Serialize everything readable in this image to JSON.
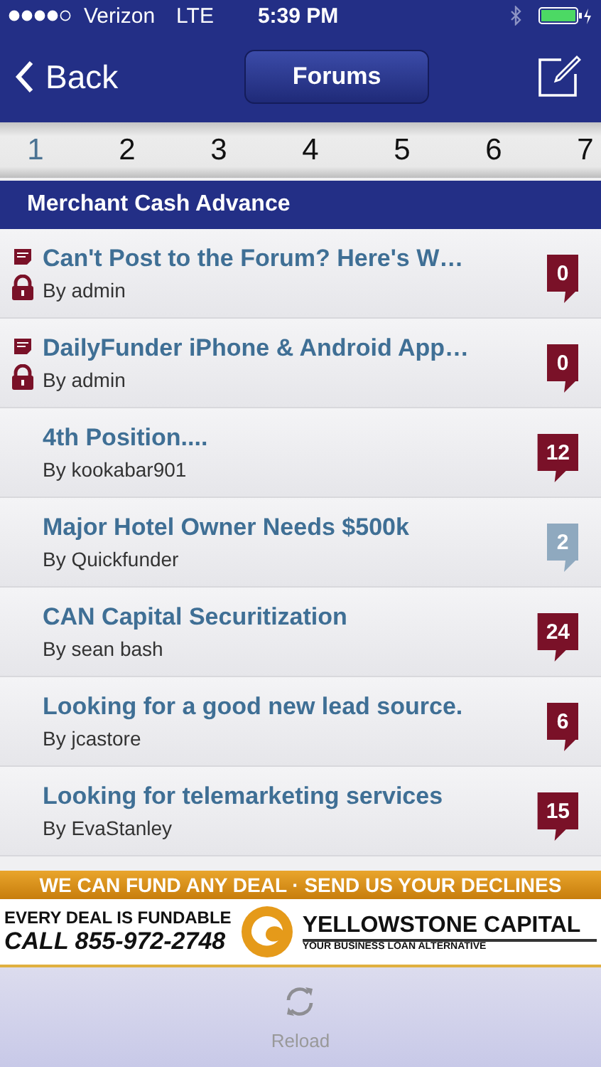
{
  "status_bar": {
    "carrier": "Verizon",
    "network": "LTE",
    "time": "5:39 PM"
  },
  "nav": {
    "back": "Back",
    "title": "Forums"
  },
  "pages": [
    {
      "label": "1",
      "selected": true
    },
    {
      "label": "2",
      "selected": false
    },
    {
      "label": "3",
      "selected": false
    },
    {
      "label": "4",
      "selected": false
    },
    {
      "label": "5",
      "selected": false
    },
    {
      "label": "6",
      "selected": false
    },
    {
      "label": "7",
      "selected": false
    }
  ],
  "section": "Merchant Cash Advance",
  "topics": [
    {
      "title": "Can't Post to the Forum? Here's W…",
      "author": "By admin",
      "pinned": true,
      "locked": true,
      "replies": "0",
      "color": "#7a1128"
    },
    {
      "title": "DailyFunder iPhone & Android App…",
      "author": "By admin",
      "pinned": true,
      "locked": true,
      "replies": "0",
      "color": "#7a1128"
    },
    {
      "title": "4th Position....",
      "author": "By kookabar901",
      "pinned": false,
      "locked": false,
      "replies": "12",
      "color": "#7a1128"
    },
    {
      "title": "Major Hotel Owner Needs $500k",
      "author": "By Quickfunder",
      "pinned": false,
      "locked": false,
      "replies": "2",
      "color": "#8fa9bf"
    },
    {
      "title": "CAN Capital Securitization",
      "author": "By sean bash",
      "pinned": false,
      "locked": false,
      "replies": "24",
      "color": "#7a1128"
    },
    {
      "title": "Looking for a good new lead source.",
      "author": "By jcastore",
      "pinned": false,
      "locked": false,
      "replies": "6",
      "color": "#7a1128"
    },
    {
      "title": "Looking for telemarketing services",
      "author": "By EvaStanley",
      "pinned": false,
      "locked": false,
      "replies": "15",
      "color": "#7a1128"
    }
  ],
  "ad": {
    "headline": "WE CAN FUND ANY DEAL · SEND US YOUR DECLINES",
    "line1": "EVERY DEAL IS FUNDABLE",
    "phone": "CALL 855-972-2748",
    "brand": "YELLOWSTONE CAPITAL",
    "tagline": "YOUR BUSINESS LOAN ALTERNATIVE"
  },
  "toolbar": {
    "reload": "Reload"
  }
}
